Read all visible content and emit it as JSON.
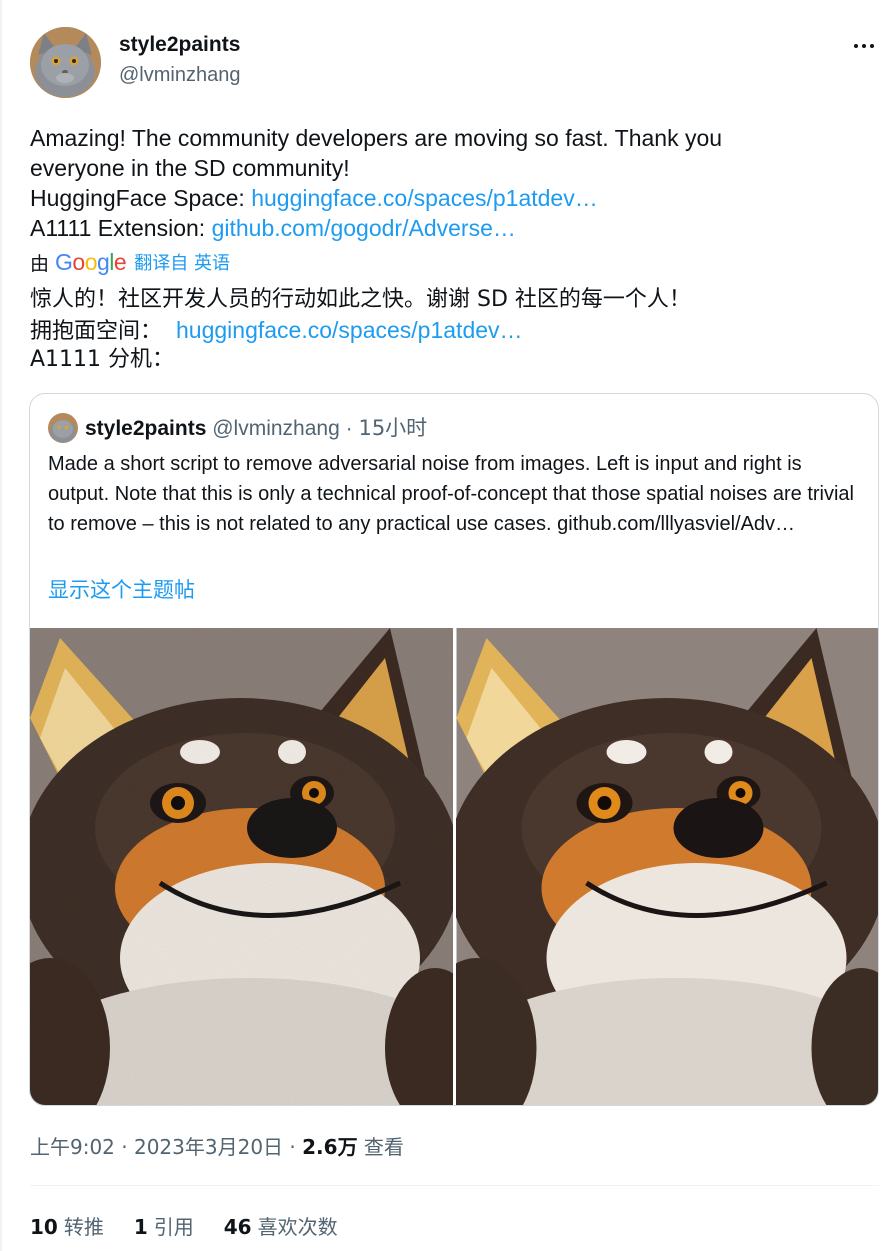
{
  "author": {
    "display_name": "style2paints",
    "handle": "@lvminzhang",
    "avatar_icon": "cat-avatar"
  },
  "more_menu_icon": "more-options-icon",
  "tweet": {
    "line1": "Amazing! The community developers are moving so fast. Thank you",
    "line2": "everyone in the SD community!",
    "hf_label": "HuggingFace Space: ",
    "hf_link": "huggingface.co/spaces/p1atdev…",
    "a1111_label": "A1111 Extension: ",
    "a1111_link": "github.com/gogodr/Adverse…"
  },
  "translation": {
    "by_label": "由",
    "google_logo": "Google",
    "action": "翻译自 英语",
    "cn_line1": "惊人的！社区开发人员的行动如此之快。谢谢 SD 社区的每一个人！",
    "cn_line2_label": "拥抱面空间：",
    "cn_line2_link": "huggingface.co/spaces/p1atdev…",
    "cn_line3": "A1111 分机："
  },
  "quote": {
    "display_name": "style2paints",
    "handle": "@lvminzhang",
    "separator": " · ",
    "time": "15小时",
    "body": "Made a short script to remove adversarial noise from images. Left is input and right is output. Note that this is only a technical proof-of-concept that those spatial noises are trivial to remove – this is not related to any practical use cases.",
    "body_link": "github.com/lllyasviel/Adv…",
    "show_thread": "显示这个主题帖",
    "image_left_alt": "fox-input-image",
    "image_right_alt": "fox-output-image"
  },
  "meta": {
    "time": "上午9:02 · 2023年3月20日 · ",
    "views_count": "2.6万",
    "views_label": " 查看"
  },
  "stats": {
    "retweets_count": "10",
    "retweets_label": "转推",
    "quotes_count": "1",
    "quotes_label": "引用",
    "likes_count": "46",
    "likes_label": "喜欢次数"
  },
  "colors": {
    "link": "#1d9bf0",
    "text": "#0f1419",
    "secondary": "#536471",
    "border": "#cfd9de"
  }
}
